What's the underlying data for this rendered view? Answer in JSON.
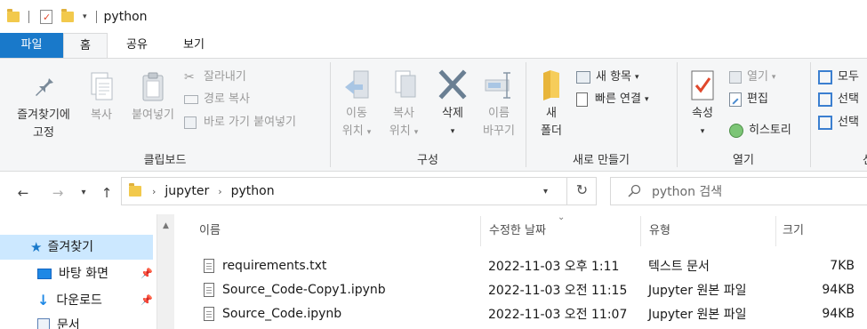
{
  "window": {
    "title": "python"
  },
  "ribbon_tabs": [
    {
      "label": "파일",
      "active": false
    },
    {
      "label": "홈",
      "active": true
    },
    {
      "label": "공유",
      "active": false
    },
    {
      "label": "보기",
      "active": false
    }
  ],
  "ribbon": {
    "clipboard": {
      "label": "클립보드",
      "pin_quick_access": "즐겨찾기에\n고정",
      "pin_line1": "즐겨찾기에",
      "pin_line2": "고정",
      "copy": "복사",
      "paste": "붙여넣기",
      "cut": "잘라내기",
      "copy_path": "경로 복사",
      "paste_shortcut": "바로 가기 붙여넣기"
    },
    "organize": {
      "label": "구성",
      "move_to_line1": "이동",
      "move_to_line2": "위치",
      "copy_to_line1": "복사",
      "copy_to_line2": "위치",
      "delete": "삭제",
      "rename_line1": "이름",
      "rename_line2": "바꾸기"
    },
    "new": {
      "label": "새로 만들기",
      "new_folder_line1": "새",
      "new_folder_line2": "폴더",
      "new_item": "새 항목",
      "easy_access": "빠른 연결"
    },
    "open": {
      "label": "열기",
      "properties": "속성",
      "open": "열기",
      "edit": "편집",
      "history": "히스토리"
    },
    "select": {
      "label": "선",
      "select_all": "모두",
      "select_none": "선택",
      "invert_selection": "선택"
    }
  },
  "address": {
    "crumbs": [
      "jupyter",
      "python"
    ],
    "search_placeholder": "python 검색"
  },
  "nav_pane": [
    {
      "label": "즐겨찾기",
      "icon": "star-icon",
      "color": "#1979ca"
    },
    {
      "label": "바탕 화면",
      "icon": "desktop-icon",
      "color": "#1e88e5"
    },
    {
      "label": "다운로드",
      "icon": "download-icon",
      "color": "#1e88e5"
    },
    {
      "label": "문서",
      "icon": "documents-icon",
      "color": "#5a7fb5"
    }
  ],
  "file_list": {
    "columns": [
      "이름",
      "수정한 날짜",
      "유형",
      "크기"
    ],
    "rows": [
      {
        "name": "requirements.txt",
        "modified": "2022-11-03 오후 1:11",
        "type": "텍스트 문서",
        "size": "7KB"
      },
      {
        "name": "Source_Code-Copy1.ipynb",
        "modified": "2022-11-03 오전 11:15",
        "type": "Jupyter 원본 파일",
        "size": "94KB"
      },
      {
        "name": "Source_Code.ipynb",
        "modified": "2022-11-03 오전 11:07",
        "type": "Jupyter 원본 파일",
        "size": "94KB"
      }
    ]
  },
  "colors": {
    "accent": "#1979ca",
    "selection": "#cce8ff",
    "folder": "#f2c94c"
  }
}
